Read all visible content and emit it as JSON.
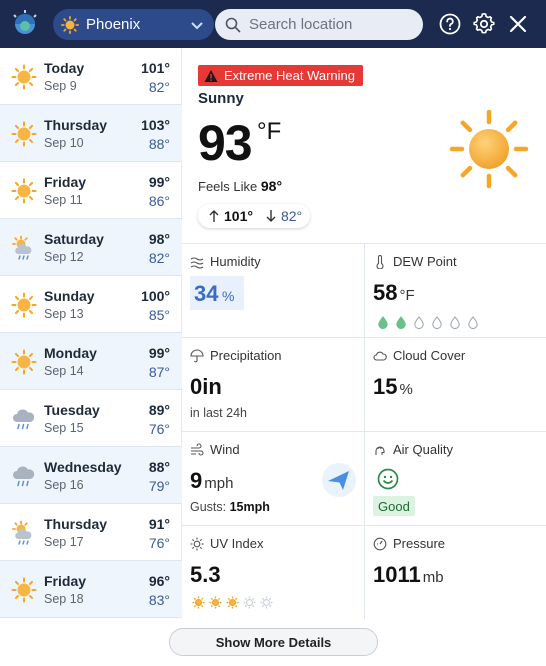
{
  "header": {
    "location": "Phoenix",
    "search_placeholder": "Search location",
    "icons": [
      "app-logo-icon",
      "sun-icon",
      "chevron-down-icon",
      "search-icon",
      "help-icon",
      "gear-icon",
      "close-icon"
    ]
  },
  "forecast": [
    {
      "day": "Today",
      "date": "Sep 9",
      "high": "101°",
      "low": "82°",
      "icon": "sun-icon"
    },
    {
      "day": "Thursday",
      "date": "Sep 10",
      "high": "103°",
      "low": "88°",
      "icon": "sun-icon"
    },
    {
      "day": "Friday",
      "date": "Sep 11",
      "high": "99°",
      "low": "86°",
      "icon": "sun-icon"
    },
    {
      "day": "Saturday",
      "date": "Sep 12",
      "high": "98°",
      "low": "82°",
      "icon": "sun-cloud-rain-icon"
    },
    {
      "day": "Sunday",
      "date": "Sep 13",
      "high": "100°",
      "low": "85°",
      "icon": "sun-icon"
    },
    {
      "day": "Monday",
      "date": "Sep 14",
      "high": "99°",
      "low": "87°",
      "icon": "sun-icon"
    },
    {
      "day": "Tuesday",
      "date": "Sep 15",
      "high": "89°",
      "low": "76°",
      "icon": "rain-cloud-icon"
    },
    {
      "day": "Wednesday",
      "date": "Sep 16",
      "high": "88°",
      "low": "79°",
      "icon": "rain-cloud-icon"
    },
    {
      "day": "Thursday",
      "date": "Sep 17",
      "high": "91°",
      "low": "76°",
      "icon": "sun-cloud-rain-icon"
    },
    {
      "day": "Friday",
      "date": "Sep 18",
      "high": "96°",
      "low": "83°",
      "icon": "sun-icon"
    }
  ],
  "current": {
    "warning": "Extreme Heat Warning",
    "condition": "Sunny",
    "temp": "93",
    "unit": "°F",
    "feels_label": "Feels Like",
    "feels_value": "98°",
    "high": "101°",
    "low": "82°"
  },
  "details": {
    "humidity": {
      "title": "Humidity",
      "value": "34",
      "unit": "%"
    },
    "dew_point": {
      "title": "DEW Point",
      "value": "58",
      "unit": "°F",
      "drops_filled": 2,
      "drops_total": 6
    },
    "precipitation": {
      "title": "Precipitation",
      "value": "0in",
      "sub": "in last 24h"
    },
    "cloud_cover": {
      "title": "Cloud Cover",
      "value": "15",
      "unit": "%"
    },
    "wind": {
      "title": "Wind",
      "value": "9",
      "unit": "mph",
      "gusts_label": "Gusts:",
      "gusts_value": "15mph"
    },
    "air_quality": {
      "title": "Air Quality",
      "status": "Good"
    },
    "uv_index": {
      "title": "UV Index",
      "value": "5.3",
      "level_filled": 3,
      "level_total": 5
    },
    "pressure": {
      "title": "Pressure",
      "value": "1011",
      "unit": "mb"
    }
  },
  "footer": {
    "more_label": "Show More Details"
  },
  "colors": {
    "header_bg": "#1b2a4e",
    "select_bg": "#2d4a8a",
    "warning": "#e53935",
    "sun": "#f5a623",
    "humidity": "#3b6bc4",
    "good": "#1d6b2f"
  }
}
